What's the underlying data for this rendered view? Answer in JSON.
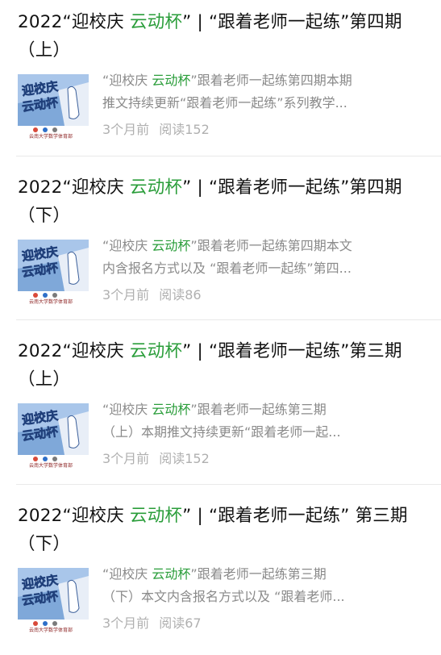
{
  "articles": [
    {
      "title_prefix": "2022“迎校庆 ",
      "title_highlight": "云动杯",
      "title_suffix": "” | “跟着老师一起练”第四期（上）",
      "summary_prefix": "“迎校庆 ",
      "summary_highlight": "云动杯",
      "summary_line1_rest": "”跟着老师一起练第四期本期",
      "summary_line2": "推文持续更新“跟着老师一起练”系列教学...",
      "time": "3个月前",
      "reads_label": "阅读",
      "reads": "152"
    },
    {
      "title_prefix": "2022“迎校庆 ",
      "title_highlight": "云动杯",
      "title_suffix": "” | “跟着老师一起练”第四期（下）",
      "summary_prefix": "“迎校庆 ",
      "summary_highlight": "云动杯",
      "summary_line1_rest": "”跟着老师一起练第四期本文",
      "summary_line2": "内含报名方式以及 “跟着老师一起练”第四...",
      "time": "3个月前",
      "reads_label": "阅读",
      "reads": "86"
    },
    {
      "title_prefix": "2022“迎校庆 ",
      "title_highlight": "云动杯",
      "title_suffix": "” | “跟着老师一起练”第三期（上）",
      "summary_prefix": "“迎校庆 ",
      "summary_highlight": "云动杯",
      "summary_line1_rest": "”跟着老师一起练第三期",
      "summary_line2": "（上）本期推文持续更新“跟着老师一起...",
      "time": "3个月前",
      "reads_label": "阅读",
      "reads": "152"
    },
    {
      "title_prefix": "2022“迎校庆 ",
      "title_highlight": "云动杯",
      "title_suffix": "” | “跟着老师一起练” 第三期（下）",
      "summary_prefix": "“迎校庆 ",
      "summary_highlight": "云动杯",
      "summary_line1_rest": "”跟着老师一起练第三期",
      "summary_line2": "（下）本文内含报名方式以及 “跟着老师...",
      "time": "3个月前",
      "reads_label": "阅读",
      "reads": "67"
    }
  ],
  "thumbnail": {
    "headline_line1": "迎校庆",
    "headline_line2": "云动杯",
    "caption": "云南大学数学体育部",
    "icon": "campus-sports-poster"
  },
  "colors": {
    "highlight": "#2a9d3a",
    "summary_text": "#8a8a8a",
    "meta_text": "#b0b0b0",
    "thumb_bg": "#7fa8d9"
  }
}
